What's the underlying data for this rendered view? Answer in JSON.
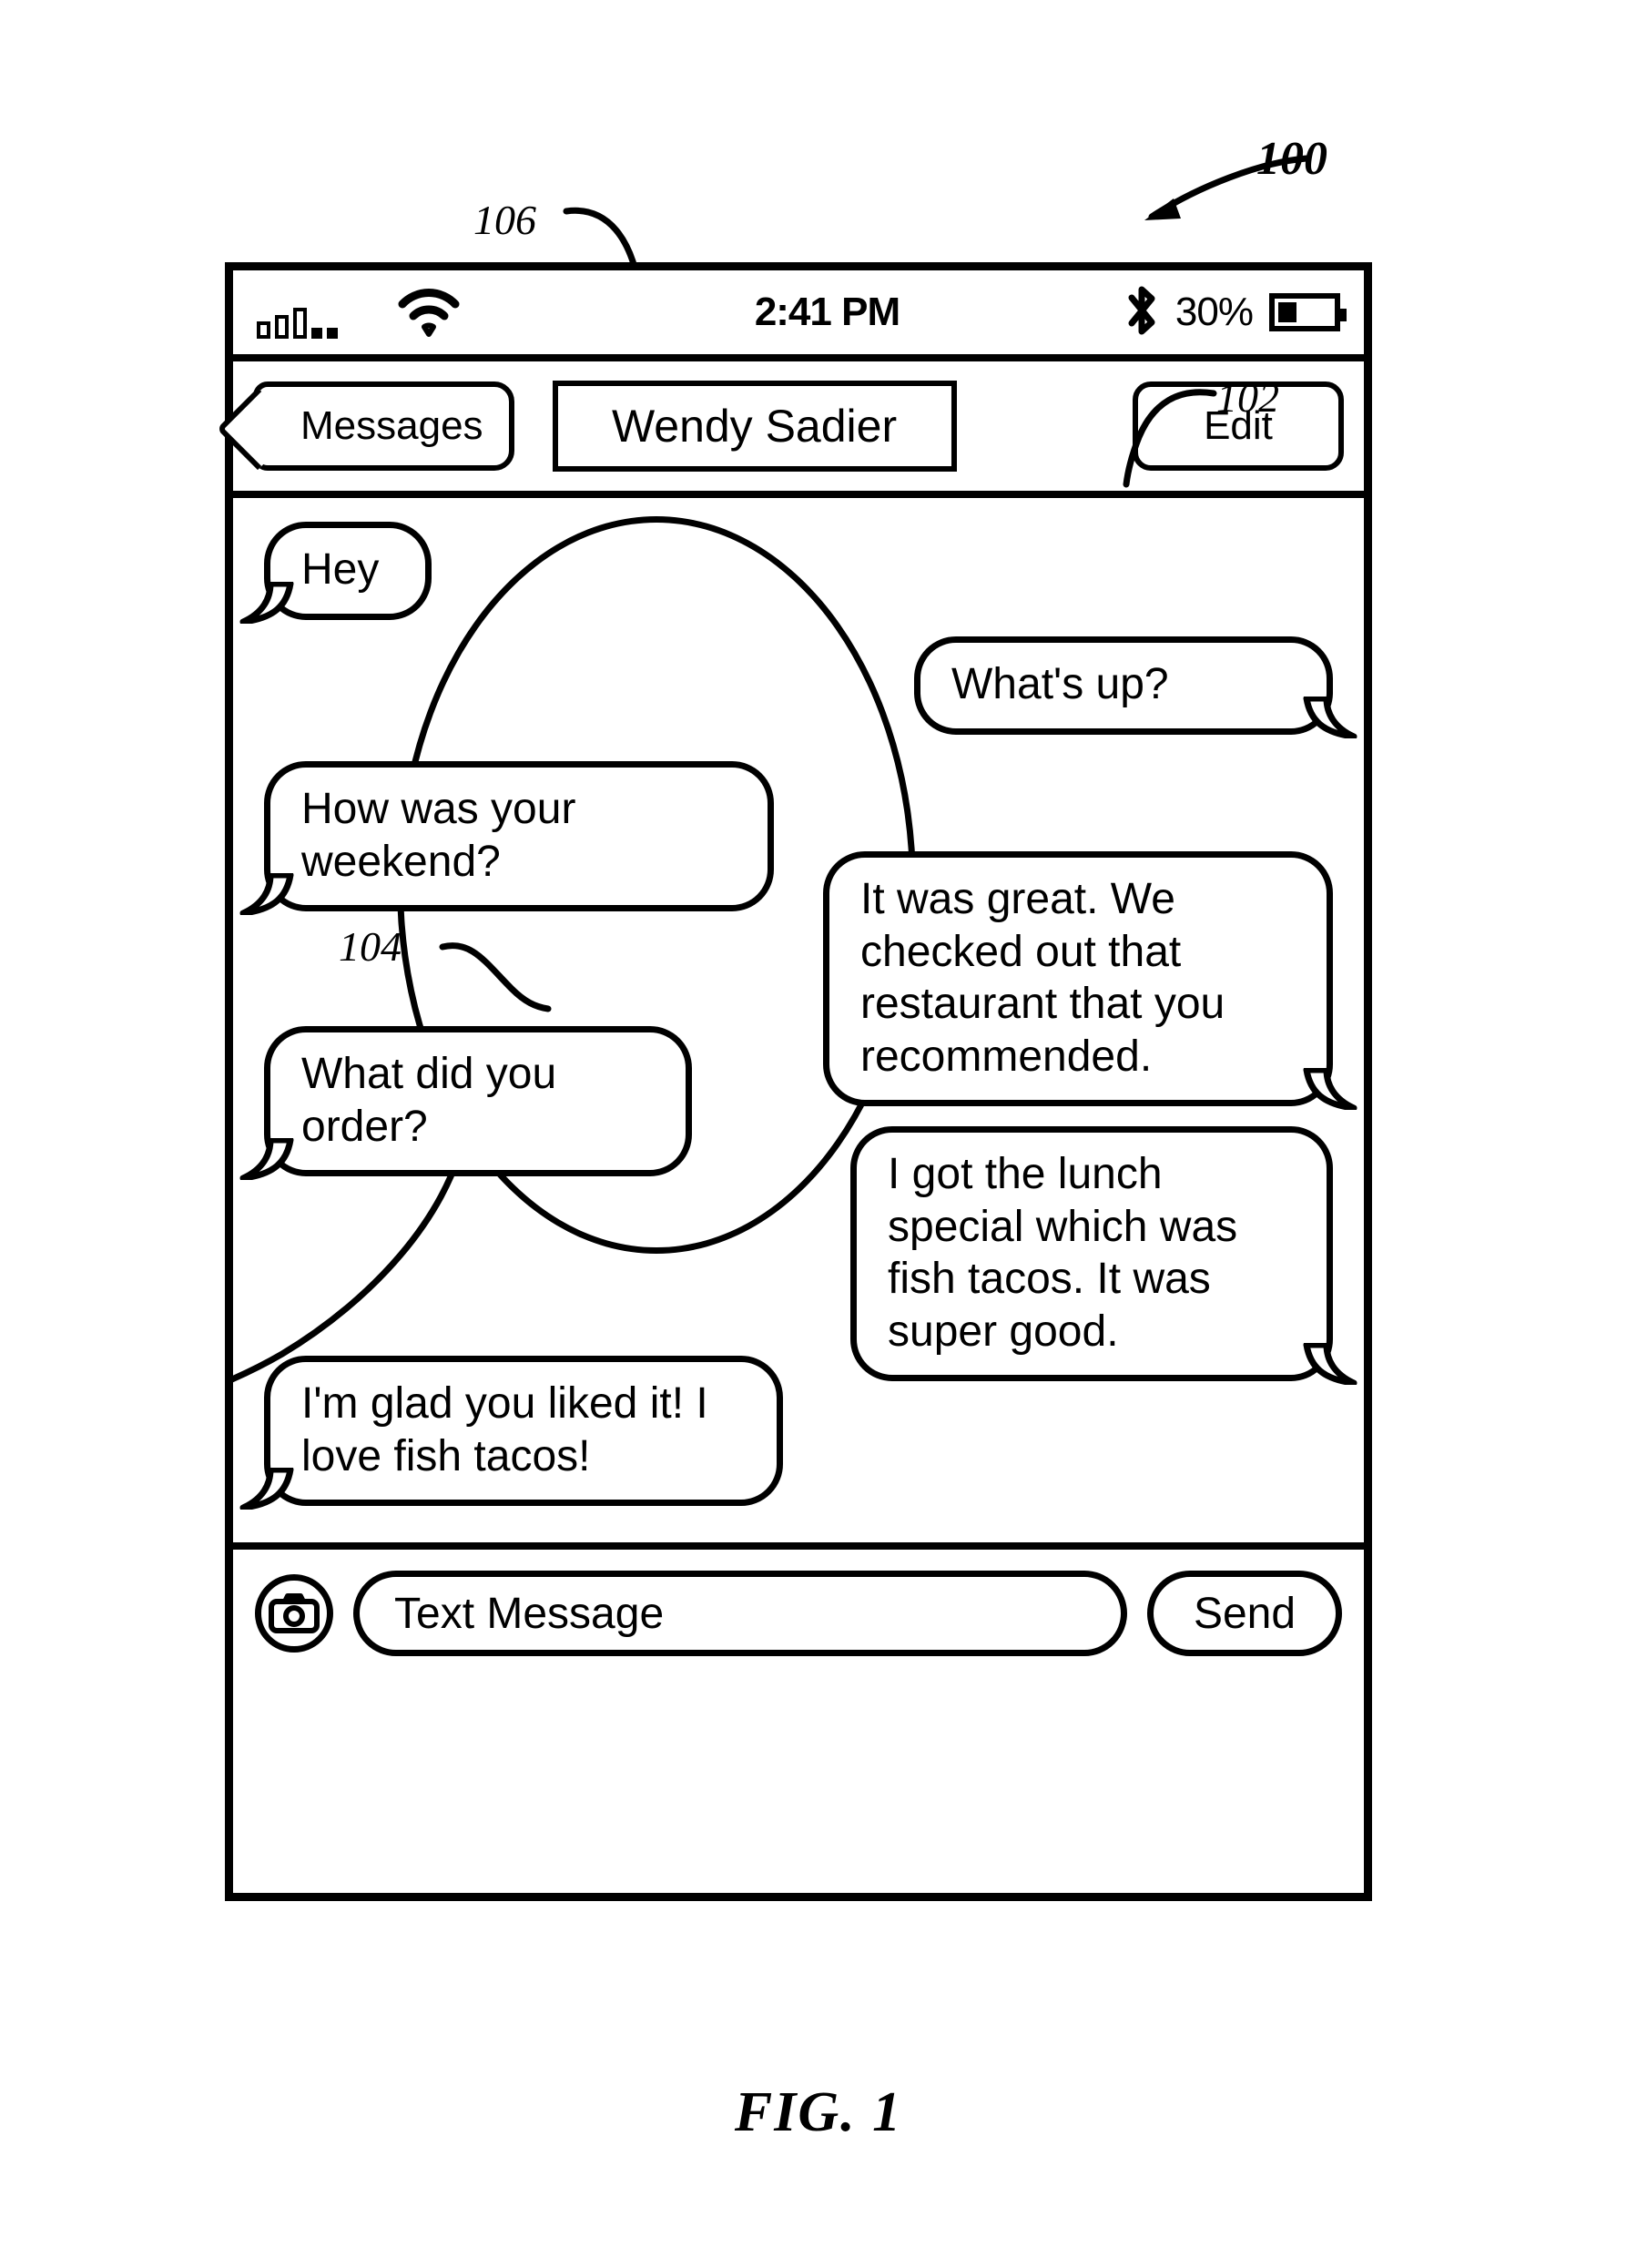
{
  "figure": {
    "caption": "FIG. 1",
    "ref_overall": "100",
    "ref_outgoing_bubble": "102",
    "ref_selection_circle": "104",
    "ref_title_bar": "106"
  },
  "status_bar": {
    "signal_icon": "cellular-signal-icon",
    "wifi_icon": "wifi-icon",
    "time": "2:41 PM",
    "bluetooth_icon": "bluetooth-icon",
    "battery_percent": "30%",
    "battery_icon": "battery-icon",
    "battery_level": 30
  },
  "nav_bar": {
    "back_label": "Messages",
    "back_icon": "chevron-left-icon",
    "title": "Wendy Sadier",
    "edit_label": "Edit"
  },
  "conversation": {
    "messages": [
      {
        "id": "m1",
        "text": "Hey",
        "side": "left"
      },
      {
        "id": "m2",
        "text": "What's up?",
        "side": "right"
      },
      {
        "id": "m3",
        "text": "How was your weekend?",
        "side": "left"
      },
      {
        "id": "m4",
        "text": "It was great. We checked out that restaurant that you recommended.",
        "side": "right"
      },
      {
        "id": "m5",
        "text": "What did you order?",
        "side": "left"
      },
      {
        "id": "m6",
        "text": "I got the lunch special which was fish tacos. It was super good.",
        "side": "right"
      },
      {
        "id": "m7",
        "text": "I'm glad you liked it! I love fish tacos!",
        "side": "left"
      }
    ]
  },
  "input_bar": {
    "camera_icon": "camera-icon",
    "text_placeholder": "Text Message",
    "send_label": "Send"
  }
}
